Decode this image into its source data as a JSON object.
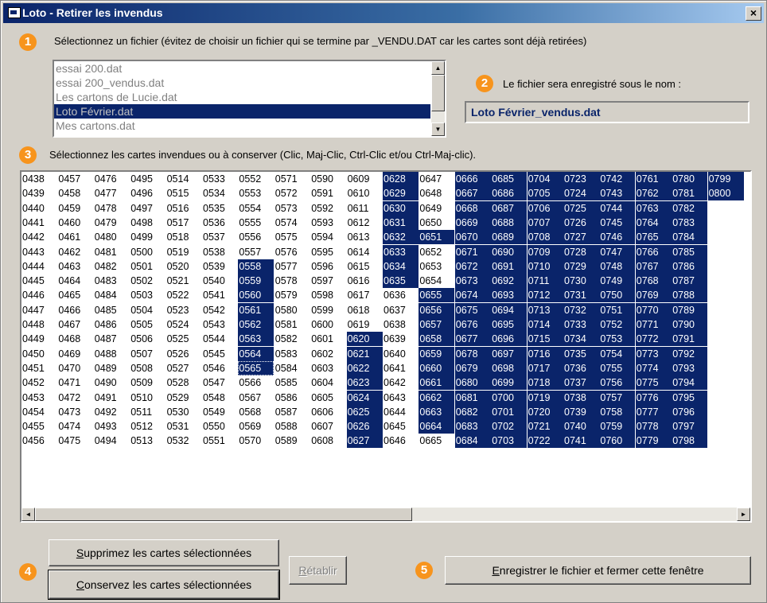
{
  "window": {
    "title": "Loto - Retirer les invendus",
    "close_label": "×"
  },
  "steps": {
    "step1": "1",
    "step2": "2",
    "step3": "3",
    "step4": "4",
    "step5": "5"
  },
  "instructions": {
    "select_file": "Sélectionnez un fichier (évitez de choisir un fichier qui se termine par _VENDU.DAT car les cartes sont déjà retirées)",
    "save_as": "Le fichier sera enregistré sous le nom :",
    "select_cards": "Sélectionnez les cartes invendues ou à conserver (Clic, Maj-Clic, Ctrl-Clic et/ou Ctrl-Maj-clic)."
  },
  "file_list": {
    "items": [
      "essai 200.dat",
      "essai 200_vendus.dat",
      "Les cartons de Lucie.dat",
      "Loto Février.dat",
      "Mes cartons.dat"
    ],
    "selected_index": 3
  },
  "output_filename": "Loto Février_vendus.dat",
  "cards": {
    "first": 438,
    "last": 800,
    "rows_per_column": 19,
    "selected_ranges": [
      [
        558,
        565
      ],
      [
        620,
        627
      ],
      [
        628,
        635
      ],
      [
        651,
        651
      ],
      [
        655,
        664
      ],
      [
        666,
        800
      ]
    ],
    "focused": 565
  },
  "buttons": {
    "delete_prefix": "S",
    "delete_rest": "upprimez les cartes sélectionnées",
    "keep_prefix": "C",
    "keep_rest": "onservez les cartes sélectionnées",
    "restore_prefix": "R",
    "restore_rest": "établir",
    "save_prefix": "E",
    "save_rest": "nregistrer le fichier et fermer cette fenêtre"
  },
  "icons": {
    "title": "window-app-icon",
    "scroll_up": "▲",
    "scroll_down": "▼",
    "scroll_left": "◄",
    "scroll_right": "►"
  }
}
